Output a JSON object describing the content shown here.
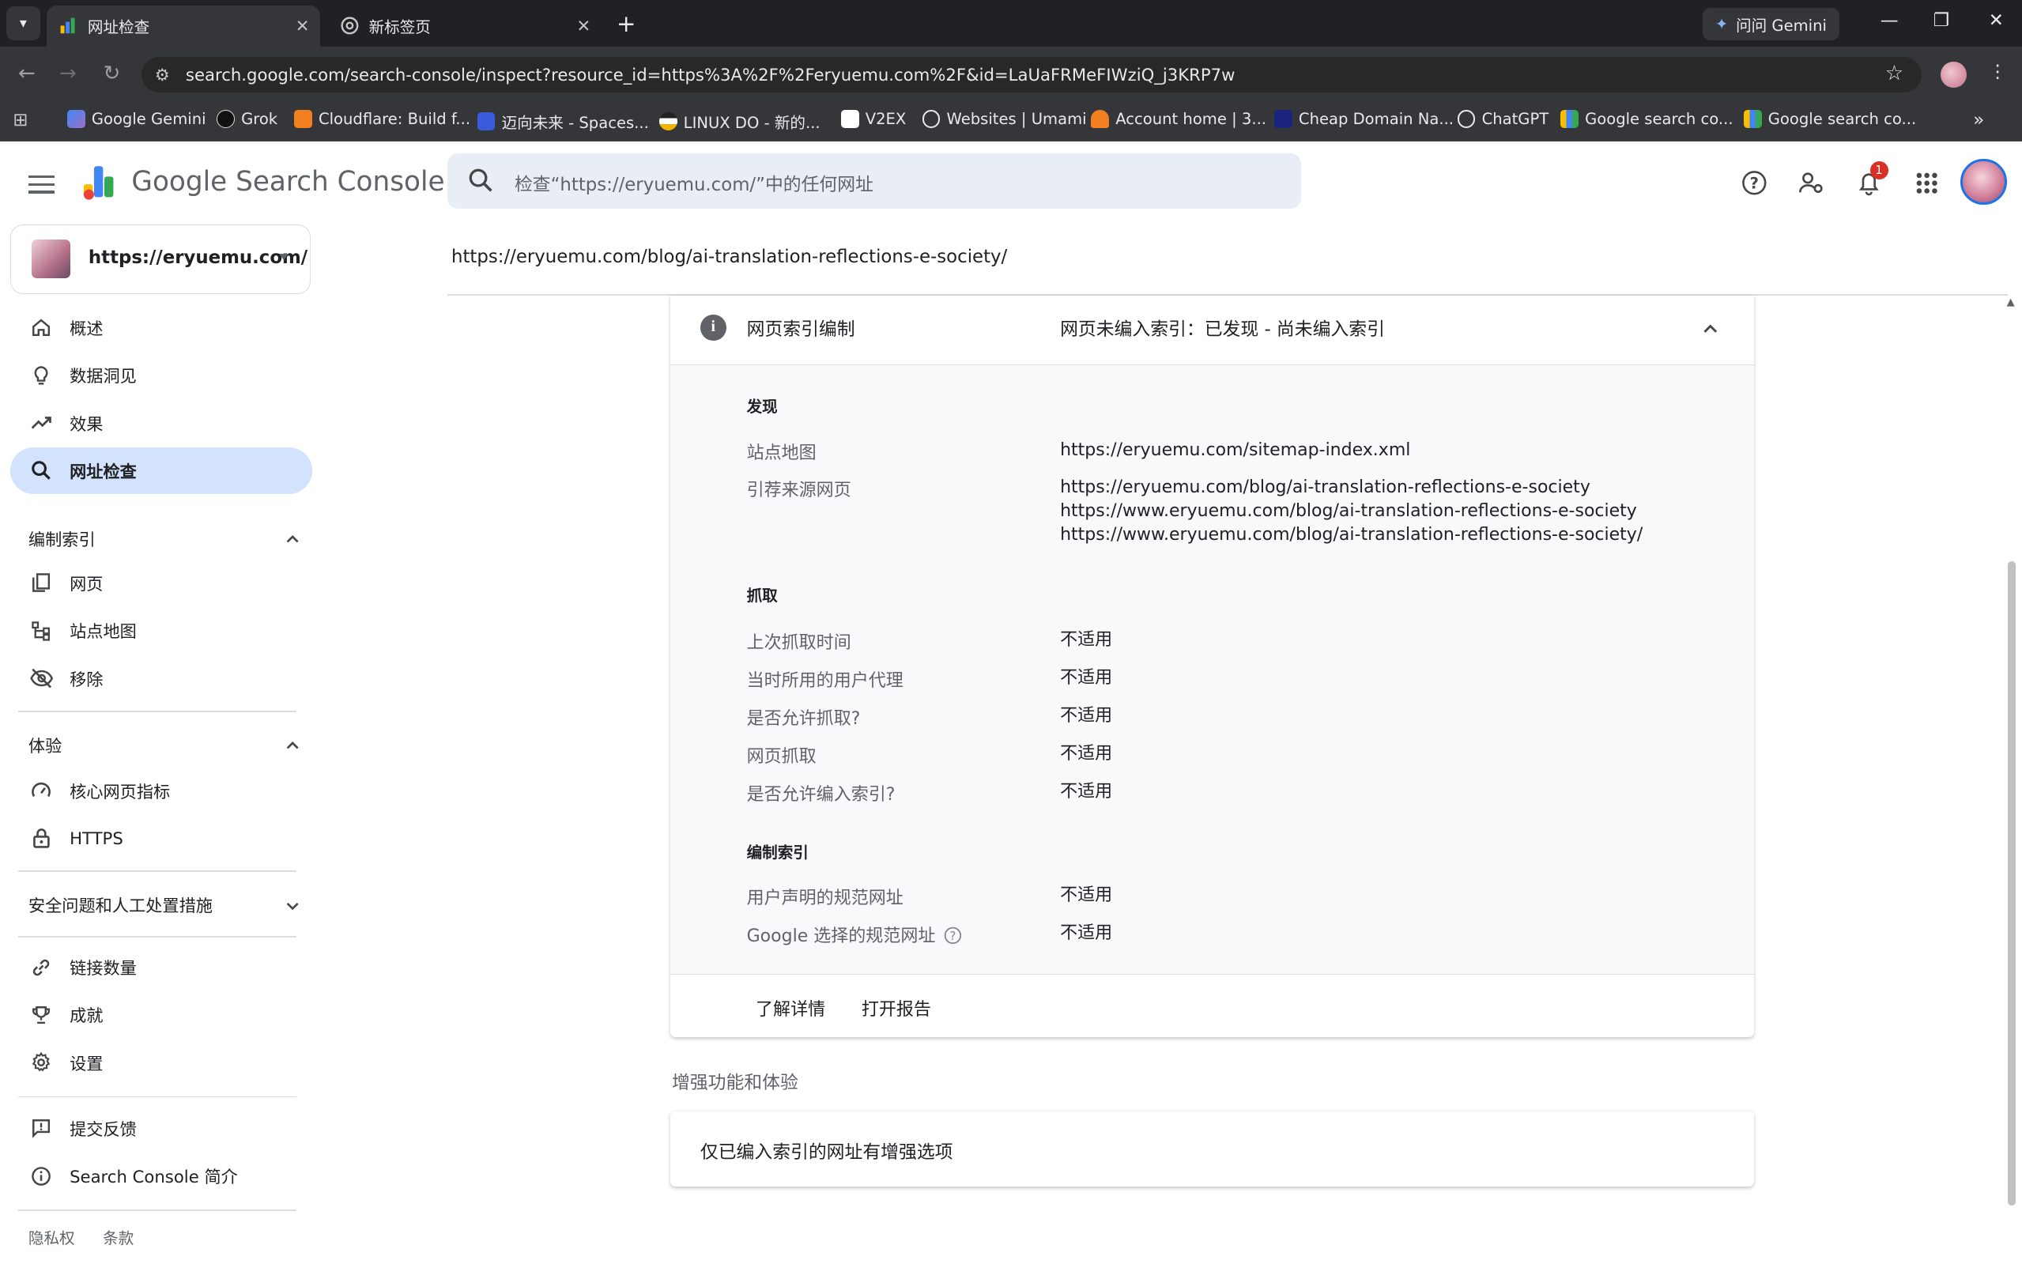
{
  "browser": {
    "tabs": [
      {
        "title": "网址检查",
        "active": true
      },
      {
        "title": "新标签页",
        "active": false
      }
    ],
    "gemini_label": "问问 Gemini",
    "url": "search.google.com/search-console/inspect?resource_id=https%3A%2F%2Feryuemu.com%2F&id=LaUaFRMeFIWziQ_j3KRP7w",
    "bookmarks": [
      "Google Gemini",
      "Grok",
      "Cloudflare: Build f...",
      "迈向未来 - Spaces...",
      "LINUX DO - 新的...",
      "V2EX",
      "Websites | Umami",
      "Account home | 3...",
      "Cheap Domain Na...",
      "ChatGPT",
      "Google search co...",
      "Google search co..."
    ]
  },
  "header": {
    "product_google": "Google",
    "product_name": "Search Console",
    "search_placeholder": "检查“https://eryuemu.com/”中的任何网址",
    "notification_count": "1"
  },
  "sidebar": {
    "property": "https://eryuemu.com/",
    "primary": [
      {
        "label": "概述",
        "icon": "home-icon"
      },
      {
        "label": "数据洞见",
        "icon": "lightbulb-icon"
      },
      {
        "label": "效果",
        "icon": "trending-up-icon"
      },
      {
        "label": "网址检查",
        "icon": "search-icon",
        "selected": true
      }
    ],
    "indexing_section": "编制索引",
    "indexing_items": [
      {
        "label": "网页",
        "icon": "pages-icon"
      },
      {
        "label": "站点地图",
        "icon": "sitemap-icon"
      },
      {
        "label": "移除",
        "icon": "visibility-off-icon"
      }
    ],
    "experience_section": "体验",
    "experience_items": [
      {
        "label": "核心网页指标",
        "icon": "speed-icon"
      },
      {
        "label": "HTTPS",
        "icon": "lock-icon"
      }
    ],
    "security_section": "安全问题和人工处置措施",
    "other_items": [
      {
        "label": "链接数量",
        "icon": "link-icon"
      },
      {
        "label": "成就",
        "icon": "trophy-icon"
      },
      {
        "label": "设置",
        "icon": "gear-icon"
      }
    ],
    "bottom_items": [
      {
        "label": "提交反馈",
        "icon": "feedback-icon"
      },
      {
        "label": "Search Console 简介",
        "icon": "info-icon"
      }
    ],
    "footer": {
      "privacy": "隐私权",
      "terms": "条款"
    }
  },
  "main": {
    "inspected_url": "https://eryuemu.com/blog/ai-translation-reflections-e-society/",
    "indexing_card": {
      "title": "网页索引编制",
      "status": "网页未编入索引：已发现 - 尚未编入索引",
      "discovery": {
        "heading": "发现",
        "sitemap_label": "站点地图",
        "sitemap_value": "https://eryuemu.com/sitemap-index.xml",
        "referring_label": "引荐来源网页",
        "referring_values": [
          "https://eryuemu.com/blog/ai-translation-reflections-e-society",
          "https://www.eryuemu.com/blog/ai-translation-reflections-e-society",
          "https://www.eryuemu.com/blog/ai-translation-reflections-e-society/"
        ]
      },
      "crawl": {
        "heading": "抓取",
        "rows": [
          {
            "label": "上次抓取时间",
            "value": "不适用"
          },
          {
            "label": "当时所用的用户代理",
            "value": "不适用"
          },
          {
            "label": "是否允许抓取?",
            "value": "不适用"
          },
          {
            "label": "网页抓取",
            "value": "不适用"
          },
          {
            "label": "是否允许编入索引?",
            "value": "不适用"
          }
        ]
      },
      "indexing": {
        "heading": "编制索引",
        "rows": [
          {
            "label": "用户声明的规范网址",
            "value": "不适用"
          },
          {
            "label": "Google 选择的规范网址",
            "value": "不适用"
          }
        ]
      },
      "learn_more": "了解详情",
      "open_report": "打开报告"
    },
    "enhancements": {
      "title": "增强功能和体验",
      "message": "仅已编入索引的网址有增强选项"
    }
  }
}
